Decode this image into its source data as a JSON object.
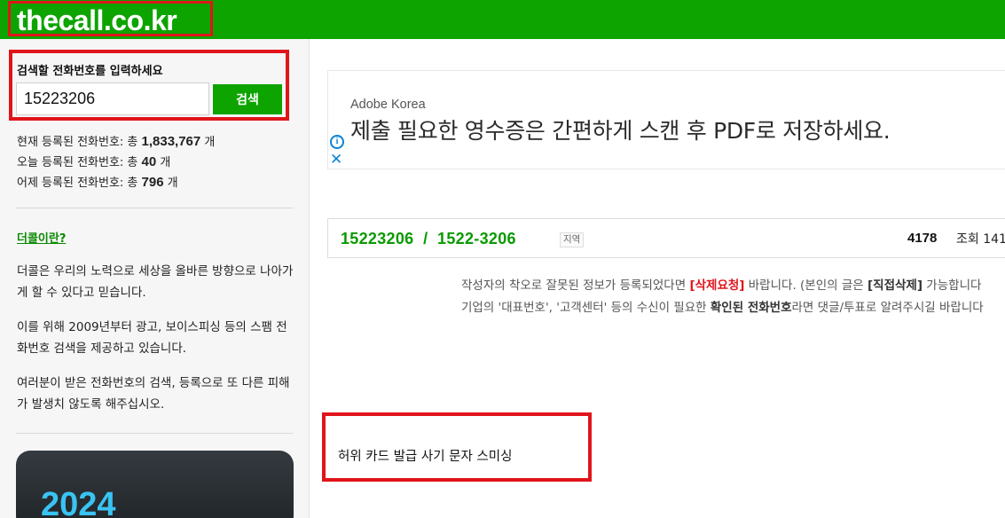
{
  "header": {
    "logo": "thecall.co.kr",
    "bg_color": "#0da400"
  },
  "search": {
    "label": "검색할 전화번호를 입력하세요",
    "value": "15223206",
    "button_label": "검색"
  },
  "stats": [
    {
      "prefix": "현재 등록된 전화번호: 총 ",
      "value": "1,833,767",
      "suffix": " 개"
    },
    {
      "prefix": "오늘 등록된 전화번호: 총 ",
      "value": "40",
      "suffix": " 개"
    },
    {
      "prefix": "어제 등록된 전화번호: 총 ",
      "value": "796",
      "suffix": " 개"
    }
  ],
  "about": {
    "link": "더콜이란?",
    "paragraphs": [
      "더콜은 우리의 노력으로 세상을 올바른 방향으로 나아가게 할 수 있다고 믿습니다.",
      "이를 위해 2009년부터 광고, 보이스피싱 등의 스팸 전화번호 검색을 제공하고 있습니다.",
      "여러분이 받은 전화번호의 검색, 등록으로 또 다른 피해가 발생치 않도록 해주십시오."
    ]
  },
  "banner": {
    "year": "2024"
  },
  "ad": {
    "brand": "Adobe Korea",
    "title": "제출 필요한 영수증은 간편하게 스캔 후 PDF로 저장하세요.",
    "info_icon": "i",
    "close_icon": "✕"
  },
  "number_card": {
    "number": "15223206",
    "separator": "/",
    "formatted": "1522-3206",
    "region_tag": "지역",
    "views": "4178",
    "views_label": "조회 141"
  },
  "notice": {
    "line1_a": "작성자의 착오로 잘못된 정보가 등록되었다면 ",
    "line1_red": "[삭제요청]",
    "line1_b": " 바랍니다. (본인의 글은 ",
    "line1_bold": "[직접삭제]",
    "line1_c": " 가능합니다",
    "line2_a": "기업의 '대표번호', '고객센터' 등의 수신이 필요한 ",
    "line2_bold": "확인된 전화번호",
    "line2_b": "라면 댓글/투표로 알려주시길 바랍니다"
  },
  "comment": {
    "text": "허위 카드 발급 사기 문자 스미싱"
  }
}
